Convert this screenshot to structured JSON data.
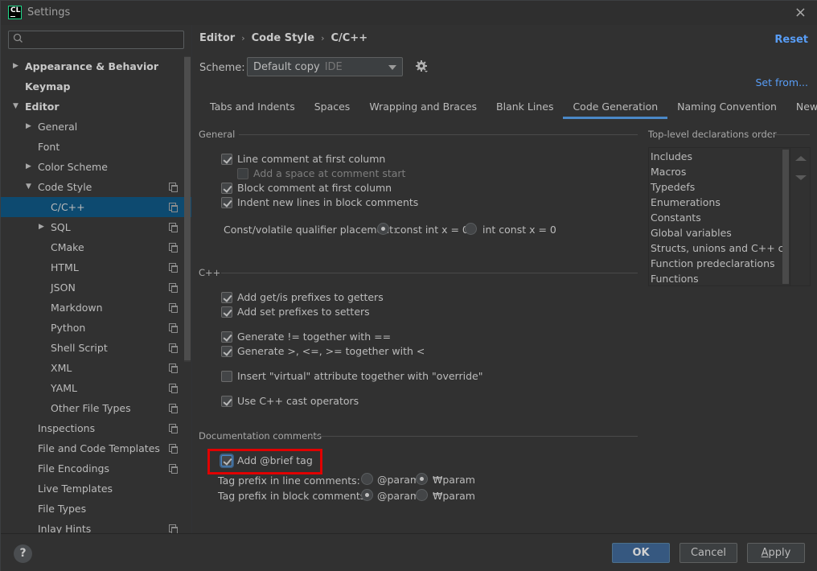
{
  "window": {
    "app_logo": "CL",
    "title": "Settings",
    "close_icon": "×"
  },
  "sidebar": {
    "search": {
      "value": "",
      "placeholder": ""
    },
    "items": [
      {
        "label": "Appearance & Behavior",
        "level": 0,
        "expander": "collapsed",
        "bold": true,
        "copy": false
      },
      {
        "label": "Keymap",
        "level": 0,
        "expander": "none",
        "bold": true,
        "copy": false
      },
      {
        "label": "Editor",
        "level": 0,
        "expander": "expanded",
        "bold": true,
        "copy": false
      },
      {
        "label": "General",
        "level": 1,
        "expander": "collapsed",
        "copy": false
      },
      {
        "label": "Font",
        "level": 1,
        "expander": "none",
        "copy": false
      },
      {
        "label": "Color Scheme",
        "level": 1,
        "expander": "collapsed",
        "copy": false
      },
      {
        "label": "Code Style",
        "level": 1,
        "expander": "expanded",
        "copy": true
      },
      {
        "label": "C/C++",
        "level": 2,
        "expander": "none",
        "copy": true,
        "selected": true
      },
      {
        "label": "SQL",
        "level": 2,
        "expander": "collapsed",
        "copy": true
      },
      {
        "label": "CMake",
        "level": 2,
        "expander": "none",
        "copy": true
      },
      {
        "label": "HTML",
        "level": 2,
        "expander": "none",
        "copy": true
      },
      {
        "label": "JSON",
        "level": 2,
        "expander": "none",
        "copy": true
      },
      {
        "label": "Markdown",
        "level": 2,
        "expander": "none",
        "copy": true
      },
      {
        "label": "Python",
        "level": 2,
        "expander": "none",
        "copy": true
      },
      {
        "label": "Shell Script",
        "level": 2,
        "expander": "none",
        "copy": true
      },
      {
        "label": "XML",
        "level": 2,
        "expander": "none",
        "copy": true
      },
      {
        "label": "YAML",
        "level": 2,
        "expander": "none",
        "copy": true
      },
      {
        "label": "Other File Types",
        "level": 2,
        "expander": "none",
        "copy": true
      },
      {
        "label": "Inspections",
        "level": 1,
        "expander": "none",
        "copy": true
      },
      {
        "label": "File and Code Templates",
        "level": 1,
        "expander": "none",
        "copy": true
      },
      {
        "label": "File Encodings",
        "level": 1,
        "expander": "none",
        "copy": true
      },
      {
        "label": "Live Templates",
        "level": 1,
        "expander": "none",
        "copy": false
      },
      {
        "label": "File Types",
        "level": 1,
        "expander": "none",
        "copy": false
      },
      {
        "label": "Inlay Hints",
        "level": 1,
        "expander": "none",
        "copy": true
      }
    ]
  },
  "main": {
    "breadcrumb": [
      "Editor",
      "Code Style",
      "C/C++"
    ],
    "breadcrumb_sep": "›",
    "reset_label": "Reset",
    "scheme": {
      "label": "Scheme:",
      "value": "Default copy",
      "tag": "IDE"
    },
    "set_from_label": "Set from...",
    "tabs": [
      {
        "label": "Tabs and Indents",
        "active": false
      },
      {
        "label": "Spaces",
        "active": false
      },
      {
        "label": "Wrapping and Braces",
        "active": false
      },
      {
        "label": "Blank Lines",
        "active": false
      },
      {
        "label": "Code Generation",
        "active": true
      },
      {
        "label": "Naming Convention",
        "active": false
      },
      {
        "label": "New File",
        "active": false
      }
    ],
    "general": {
      "title": "General",
      "checkboxes": [
        {
          "label": "Line comment at first column",
          "checked": true
        },
        {
          "label": "Add a space at comment start",
          "checked": false,
          "disabled": true
        },
        {
          "label": "Block comment at first column",
          "checked": true
        },
        {
          "label": "Indent new lines in block comments",
          "checked": true
        }
      ],
      "qualifier": {
        "label": "Const/volatile qualifier placement:",
        "options": [
          {
            "label": "const int x = 0",
            "selected": true
          },
          {
            "label": "int const x = 0",
            "selected": false
          }
        ]
      }
    },
    "cpp": {
      "title": "C++",
      "checkboxes": [
        {
          "label": "Add get/is prefixes to getters",
          "checked": true
        },
        {
          "label": "Add set prefixes to setters",
          "checked": true
        },
        {
          "label": "Generate != together with ==",
          "checked": true
        },
        {
          "label": "Generate >, <=, >= together with <",
          "checked": true
        },
        {
          "label": "Insert \"virtual\" attribute together with \"override\"",
          "checked": false
        },
        {
          "label": "Use C++ cast operators",
          "checked": true
        }
      ]
    },
    "docs": {
      "title": "Documentation comments",
      "brief": {
        "label": "Add @brief tag",
        "checked": true
      },
      "line_prefix": {
        "label": "Tag prefix in line comments:",
        "options": [
          {
            "label": "@param",
            "selected": false
          },
          {
            "label": "₩param",
            "selected": true
          }
        ]
      },
      "block_prefix": {
        "label": "Tag prefix in block comments:",
        "options": [
          {
            "label": "@param",
            "selected": true
          },
          {
            "label": "₩param",
            "selected": false
          }
        ]
      }
    },
    "declarations": {
      "title": "Top-level declarations order",
      "items": [
        "Includes",
        "Macros",
        "Typedefs",
        "Enumerations",
        "Constants",
        "Global variables",
        "Structs, unions and C++ classes",
        "Function predeclarations",
        "Functions"
      ]
    }
  },
  "footer": {
    "help_label": "?",
    "ok_label": "OK",
    "cancel_label": "Cancel",
    "apply_label": "Apply"
  },
  "colors": {
    "accent": "#4a88c7",
    "link": "#589df6",
    "selection": "#0d4a70",
    "primary_button": "#365880",
    "highlight": "#e00000"
  }
}
